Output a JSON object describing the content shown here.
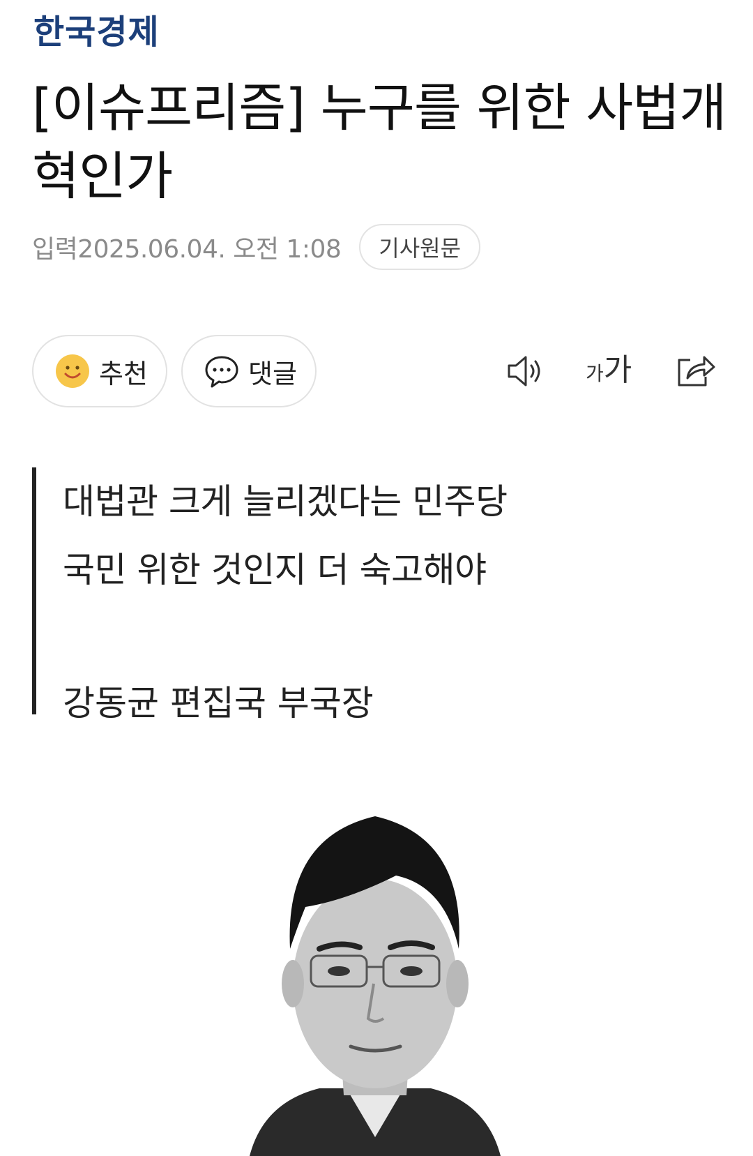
{
  "header": {
    "logo": "한국경제"
  },
  "article": {
    "headline": "[이슈프리즘] 누구를 위한 사법개혁인가",
    "date": "입력2025.06.04. 오전 1:08",
    "source_button": "기사원문"
  },
  "actions": {
    "like_label": "추천",
    "comment_label": "댓글",
    "font_size_small": "가",
    "font_size_large": "가"
  },
  "summary": {
    "lines": [
      "대법관 크게 늘리겠다는 민주당",
      "국민 위한 것인지 더 숙고해야"
    ],
    "author": "강동균 편집국 부국장"
  },
  "colors": {
    "logo": "#1c3f7a",
    "meta": "#8a8a8a",
    "quote_bar": "#222222",
    "like_icon": "#f7c64a"
  },
  "icons": [
    "smile-icon",
    "speech-bubble-icon",
    "speaker-icon",
    "font-size-icon",
    "share-icon"
  ]
}
